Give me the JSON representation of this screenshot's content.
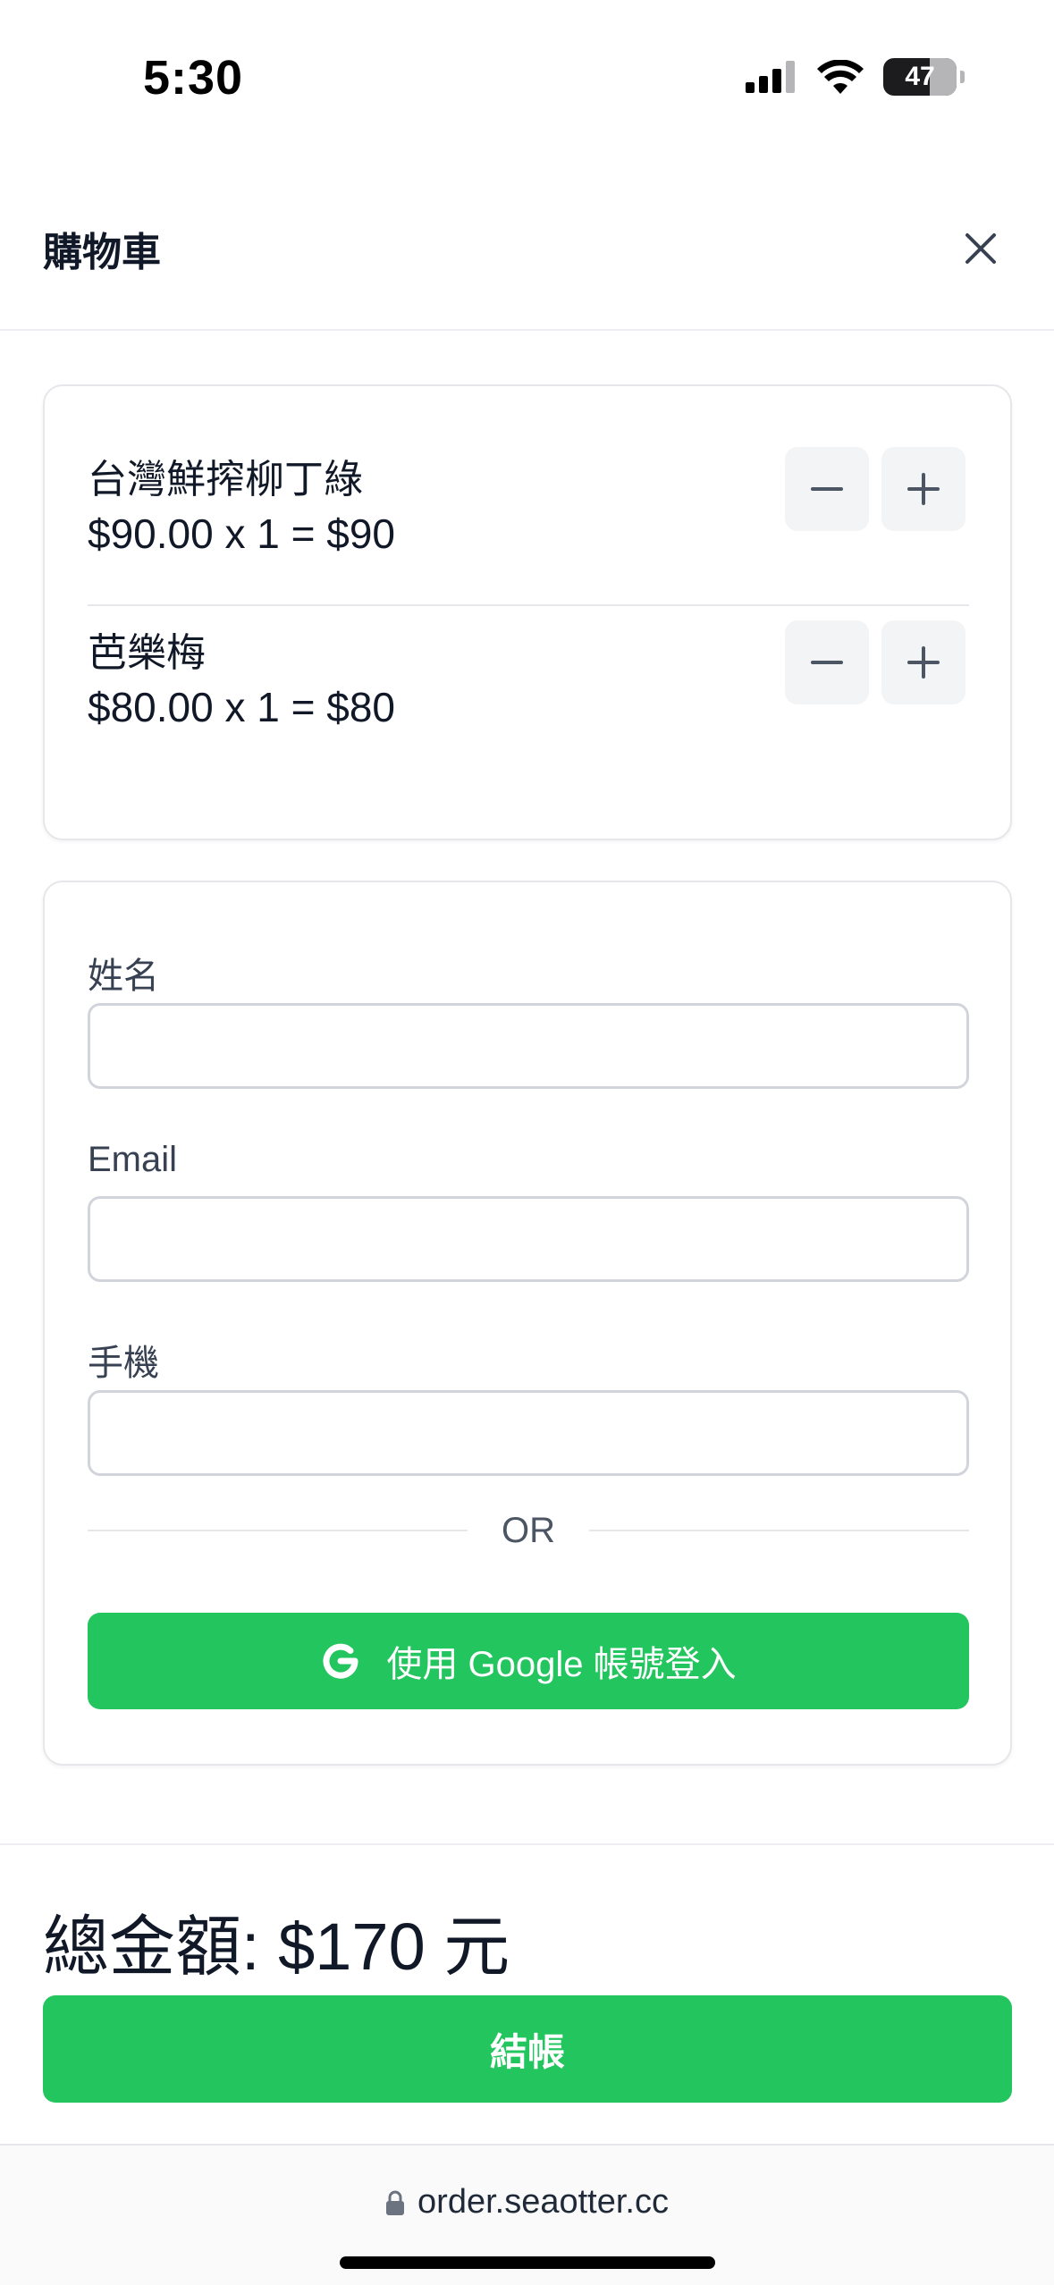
{
  "status_bar": {
    "time": "5:30",
    "battery": "47"
  },
  "header": {
    "title": "購物車"
  },
  "cart": {
    "items": [
      {
        "name": "台灣鮮搾柳丁綠",
        "price_line": "$90.00 x 1 = $90"
      },
      {
        "name": "芭樂梅",
        "price_line": "$80.00 x 1 = $80"
      }
    ]
  },
  "form": {
    "name_label": "姓名",
    "name_value": "",
    "email_label": "Email",
    "email_value": "",
    "phone_label": "手機",
    "phone_value": "",
    "or_text": "OR",
    "google_button_label": "使用 Google 帳號登入"
  },
  "footer": {
    "total": "總金額: $170 元",
    "checkout_label": "結帳"
  },
  "browser": {
    "url": "order.seaotter.cc"
  },
  "colors": {
    "accent": "#22c55e",
    "border": "#e5e7eb",
    "qty_button_bg": "#f3f4f6"
  },
  "icons": [
    "signal-icon",
    "wifi-icon",
    "battery-icon",
    "close-icon",
    "minus-icon",
    "plus-icon",
    "google-icon",
    "lock-icon"
  ]
}
